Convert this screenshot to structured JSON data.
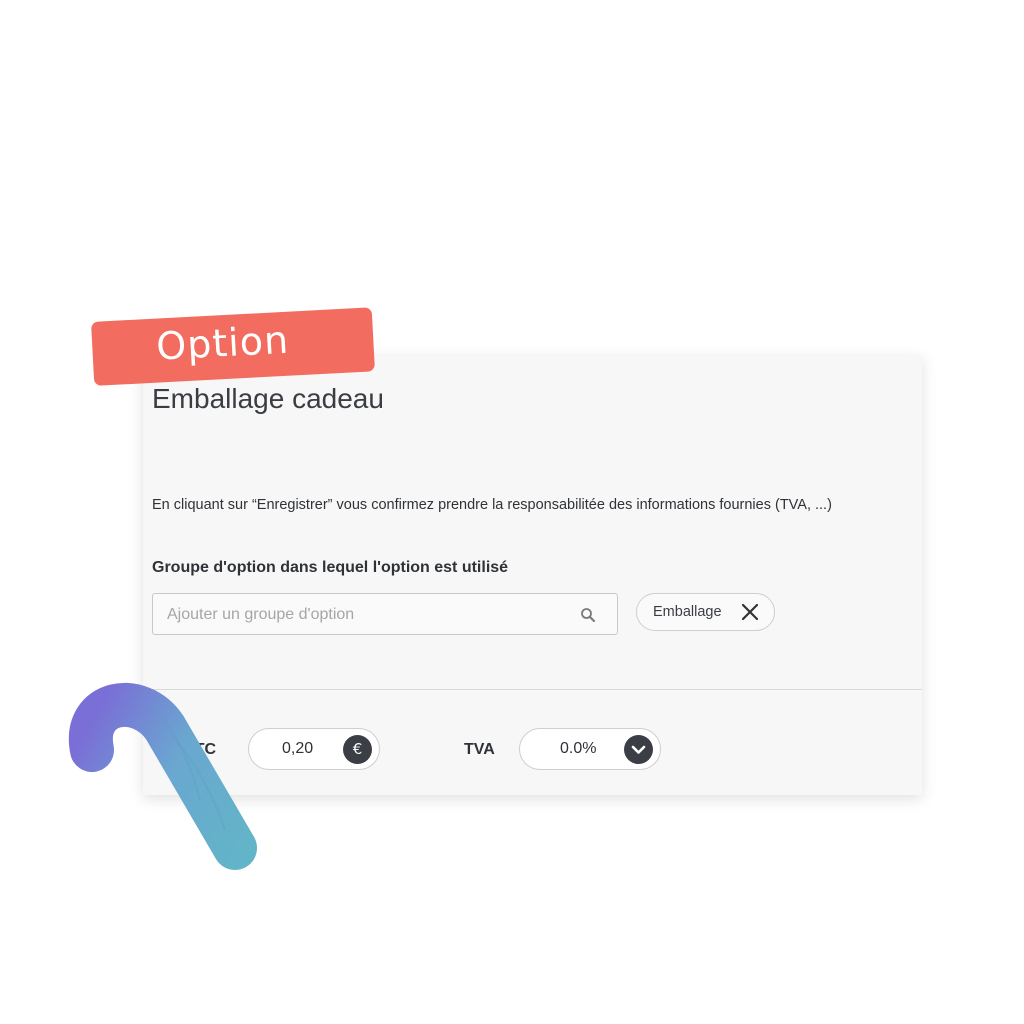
{
  "badge": {
    "label": "Option"
  },
  "card": {
    "title": "Emballage cadeau",
    "notice": "En cliquant sur “Enregistrer” vous confirmez prendre la responsabilitée des informations fournies (TVA, ...)",
    "option_group": {
      "label": "Groupe d'option dans lequel l'option est utilisé",
      "search_placeholder": "Ajouter un groupe d'option",
      "search_icon": "search-icon",
      "selected_chips": [
        {
          "label": "Emballage",
          "remove_icon": "close-icon"
        }
      ]
    },
    "price": {
      "label": "TTC",
      "value": "0,20",
      "currency_symbol": "€"
    },
    "tva": {
      "label": "TVA",
      "value": "0.0%",
      "dropdown_icon": "chevron-down-icon"
    }
  },
  "colors": {
    "ribbon": "#f26d5f",
    "card_bg": "#f7f7f7",
    "badge_dark": "#3b3e45",
    "cane_gradient": [
      "#7a6fd6",
      "#6aa7d0",
      "#62b5c8"
    ]
  }
}
